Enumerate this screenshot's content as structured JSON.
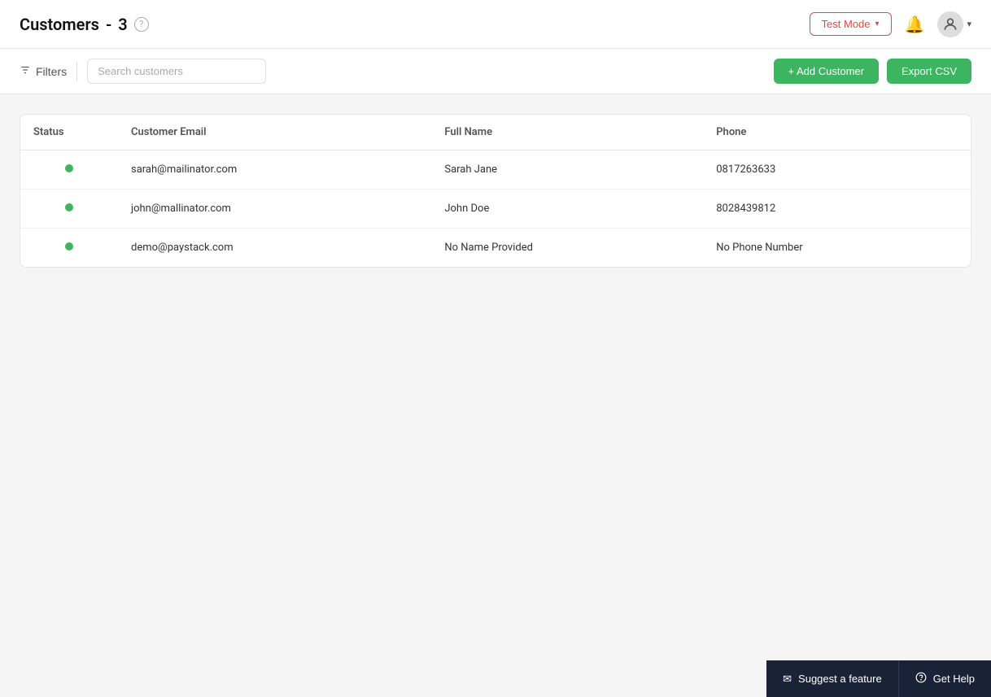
{
  "header": {
    "title": "Customers",
    "separator": "-",
    "count": "3",
    "help_tooltip": "?",
    "test_mode_label": "Test Mode",
    "chevron": "▾",
    "user_chevron": "▾"
  },
  "toolbar": {
    "filters_label": "Filters",
    "search_placeholder": "Search customers",
    "add_customer_label": "+ Add Customer",
    "export_csv_label": "Export CSV"
  },
  "table": {
    "columns": [
      {
        "key": "status",
        "label": "Status"
      },
      {
        "key": "email",
        "label": "Customer Email"
      },
      {
        "key": "name",
        "label": "Full Name"
      },
      {
        "key": "phone",
        "label": "Phone"
      }
    ],
    "rows": [
      {
        "status": "active",
        "email": "sarah@mailinator.com",
        "name": "Sarah Jane",
        "phone": "0817263633"
      },
      {
        "status": "active",
        "email": "john@mallinator.com",
        "name": "John Doe",
        "phone": "8028439812"
      },
      {
        "status": "active",
        "email": "demo@paystack.com",
        "name": "No Name Provided",
        "phone": "No Phone Number"
      }
    ]
  },
  "bottom_bar": {
    "suggest_label": "Suggest a feature",
    "get_help_label": "Get Help"
  }
}
